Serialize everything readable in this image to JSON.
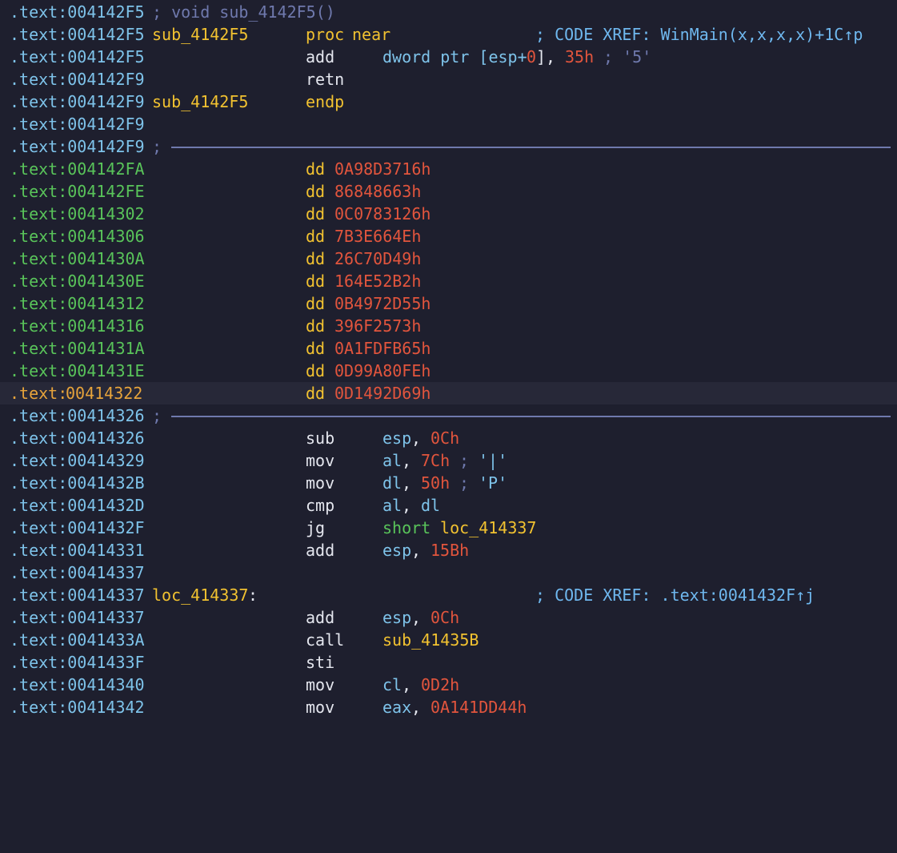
{
  "colors": {
    "background": "#1e1f2e",
    "segment": "#7ec3ea",
    "segment_data": "#59c45a",
    "segment_current": "#e6a33b",
    "label": "#f2c230",
    "number": "#e2553d",
    "comment": "#6f79ad"
  },
  "lines": [
    {
      "addr": ".text:004142F5",
      "comment": "; void sub_4142F5()"
    },
    {
      "addr": ".text:004142F5",
      "label": "sub_4142F5",
      "kw1": "proc",
      "kw2": "near",
      "xref": "; CODE XREF: WinMain(x,x,x,x)+1C↑p"
    },
    {
      "addr": ".text:004142F5",
      "mnem": "add",
      "op_a": "dword ptr [esp+",
      "op_b": "0",
      "op_c": "], ",
      "op_num": "35h",
      "op_cmt": " ; '5'"
    },
    {
      "addr": ".text:004142F9",
      "mnem": "retn"
    },
    {
      "addr": ".text:004142F9",
      "label": "sub_4142F5",
      "kw1": "endp"
    },
    {
      "addr": ".text:004142F9"
    },
    {
      "addr": ".text:004142F9",
      "sep": ";"
    },
    {
      "addr": ".text:004142FA",
      "dd": "dd",
      "val": "0A98D3716h"
    },
    {
      "addr": ".text:004142FE",
      "dd": "dd",
      "val": "86848663h"
    },
    {
      "addr": ".text:00414302",
      "dd": "dd",
      "val": "0C0783126h"
    },
    {
      "addr": ".text:00414306",
      "dd": "dd",
      "val": "7B3E664Eh"
    },
    {
      "addr": ".text:0041430A",
      "dd": "dd",
      "val": "26C70D49h"
    },
    {
      "addr": ".text:0041430E",
      "dd": "dd",
      "val": "164E52B2h"
    },
    {
      "addr": ".text:00414312",
      "dd": "dd",
      "val": "0B4972D55h"
    },
    {
      "addr": ".text:00414316",
      "dd": "dd",
      "val": "396F2573h"
    },
    {
      "addr": ".text:0041431A",
      "dd": "dd",
      "val": "0A1FDFB65h"
    },
    {
      "addr": ".text:0041431E",
      "dd": "dd",
      "val": "0D99A80FEh"
    },
    {
      "addr_seg": ".text:",
      "addr_off": "00414322",
      "dd": "dd",
      "val": "0D1492D69h"
    },
    {
      "addr": ".text:00414326",
      "sep": ";"
    },
    {
      "addr": ".text:00414326",
      "mnem": "sub",
      "op_reg": "esp",
      "op_sep": ", ",
      "op_num": "0Ch"
    },
    {
      "addr": ".text:00414329",
      "mnem": "mov",
      "op_reg": "al",
      "op_sep": ", ",
      "op_num": "7Ch",
      "op_cmt_a": " ; ",
      "op_str": "'|'"
    },
    {
      "addr": ".text:0041432B",
      "mnem": "mov",
      "op_reg": "dl",
      "op_sep": ", ",
      "op_num": "50h",
      "op_cmt_a": " ; ",
      "op_str": "'P'"
    },
    {
      "addr": ".text:0041432D",
      "mnem": "cmp",
      "op_reg": "al",
      "op_sep": ", ",
      "op_reg2": "dl"
    },
    {
      "addr": ".text:0041432F",
      "mnem": "jg",
      "op_short": "short",
      "op_target": " loc_414337"
    },
    {
      "addr": ".text:00414331",
      "mnem": "add",
      "op_reg": "esp",
      "op_sep": ", ",
      "op_num": "15Bh"
    },
    {
      "addr": ".text:00414337"
    },
    {
      "addr": ".text:00414337",
      "label": "loc_414337",
      "colon": ":",
      "xref": "; CODE XREF: .text:0041432F↑j"
    },
    {
      "addr": ".text:00414337",
      "mnem": "add",
      "op_reg": "esp",
      "op_sep": ", ",
      "op_num": "0Ch"
    },
    {
      "addr": ".text:0041433A",
      "mnem": "call",
      "op_target": "sub_41435B"
    },
    {
      "addr": ".text:0041433F",
      "mnem": "sti"
    },
    {
      "addr": ".text:00414340",
      "mnem": "mov",
      "op_reg": "cl",
      "op_sep": ", ",
      "op_num": "0D2h"
    },
    {
      "addr": ".text:00414342",
      "mnem": "mov",
      "op_reg": "eax",
      "op_sep": ", ",
      "op_num": "0A141DD44h"
    }
  ]
}
